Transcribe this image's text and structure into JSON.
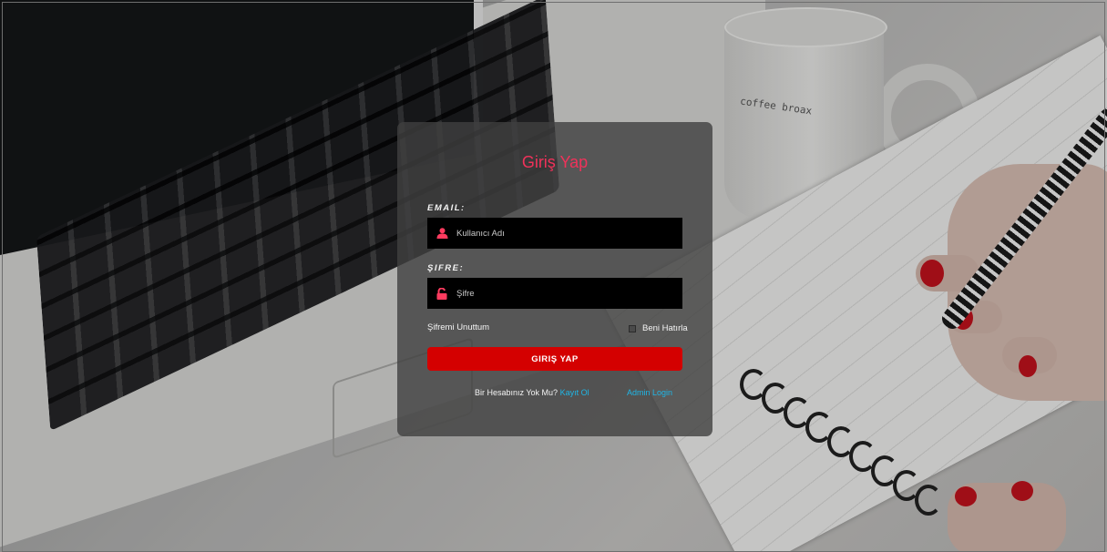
{
  "background": {
    "mug_text": "coffee broax"
  },
  "login": {
    "title": "Giriş Yap",
    "email_label": "EMAIL:",
    "email_placeholder": "Kullanıcı Adı",
    "email_icon": "user-icon",
    "password_label": "ŞIFRE:",
    "password_placeholder": "Şifre",
    "password_icon": "unlock-icon",
    "forgot_label": "Şifremi Unuttum",
    "remember_label": "Beni Hatırla",
    "remember_checked": false,
    "submit_label": "GIRIŞ YAP",
    "signup_prompt": "Bir Hesabınız Yok Mu?",
    "signup_link": "Kayıt Ol",
    "admin_link": "Admin Login"
  },
  "colors": {
    "title": "#f0325a",
    "button": "#d40000",
    "link": "#1fb6e6",
    "icon": "#ff3b5f",
    "panel": "rgba(64,64,64,0.80)"
  }
}
